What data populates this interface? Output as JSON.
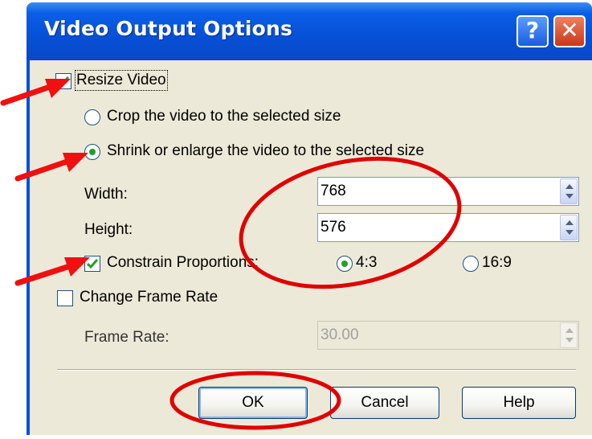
{
  "window": {
    "title": "Video Output Options",
    "help_glyph": "?",
    "close_glyph": "✕"
  },
  "resize_video": {
    "label": "Resize Video",
    "checked": true
  },
  "crop_option": {
    "label": "Crop the video to the selected size",
    "selected": false
  },
  "shrink_option": {
    "label": "Shrink or enlarge the video to the selected size",
    "selected": true
  },
  "width": {
    "label": "Width:",
    "value": "768"
  },
  "height": {
    "label": "Height:",
    "value": "576"
  },
  "constrain": {
    "label": "Constrain Proportions:",
    "checked": true
  },
  "aspect_4_3": {
    "label": "4:3",
    "selected": true
  },
  "aspect_16_9": {
    "label": "16:9",
    "selected": false
  },
  "change_frame_rate": {
    "label": "Change Frame Rate",
    "checked": false
  },
  "frame_rate": {
    "label": "Frame Rate:",
    "value": "30.00",
    "enabled": false
  },
  "buttons": {
    "ok": "OK",
    "cancel": "Cancel",
    "help": "Help"
  },
  "annotation_colors": {
    "arrow": "#f01010",
    "ellipse": "#e00000"
  },
  "colors": {
    "title_bar": "#0650d6",
    "dialog_face": "#ece9d8",
    "check": "#21a121"
  }
}
